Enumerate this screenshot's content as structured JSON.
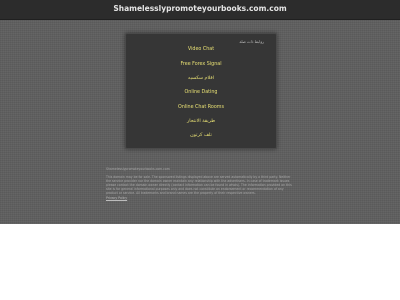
{
  "header": {
    "site_title": "Shamelesslypromoteyourbooks.com.com"
  },
  "panel": {
    "heading": "روابط ذات صلة",
    "links": [
      "Video Chat",
      "Free Forex Signal",
      "افلام سكسيه",
      "Online Dating",
      "Online Chat Rooms",
      "طريقة الانتحار",
      "تلف كرتون"
    ]
  },
  "info": {
    "title": "Shamelesslypromoteyourbooks.com.com",
    "text": "This domain may be for sale. The sponsored listings displayed above are served automatically by a third party. Neither the service provider nor the domain owner maintain any relationship with the advertisers. In case of trademark issues please contact the domain owner directly (contact information can be found in whois). The information provided on this site is for general informational purposes only and does not constitute an endorsement or recommendation of any product or service. All trademarks and brand names are the property of their respective owners.",
    "privacy_link": "Privacy Policy"
  }
}
